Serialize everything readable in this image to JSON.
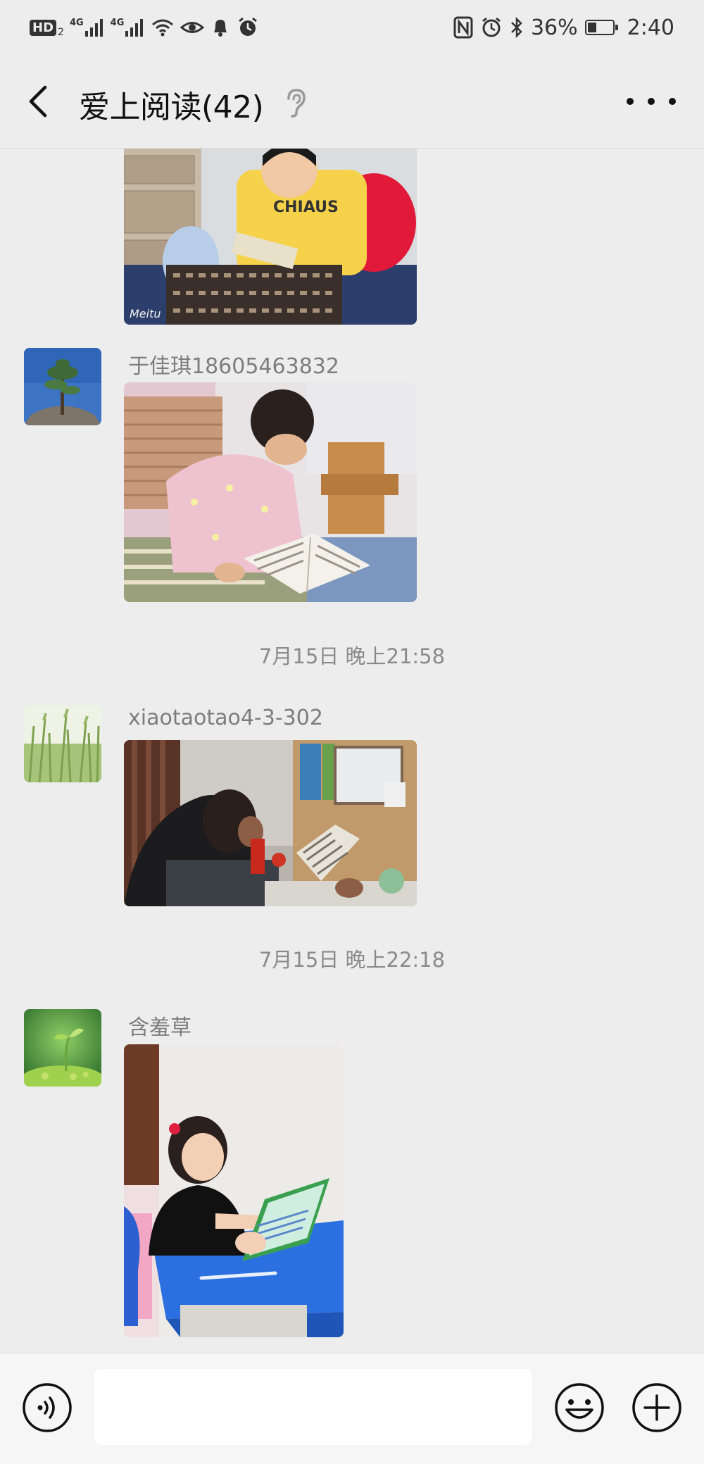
{
  "status_bar": {
    "left_badge": "HD",
    "left_badge_sub": "2",
    "network_1": "4G",
    "network_2": "4G",
    "battery_text": "36%",
    "battery_level": 0.36,
    "time": "2:40",
    "icons": [
      "signal-icon",
      "signal-icon",
      "wifi-icon",
      "eye-icon",
      "bell-icon",
      "alarm-icon",
      "nfc-icon",
      "alarm-clock-icon",
      "bluetooth-icon",
      "battery-icon"
    ]
  },
  "header": {
    "title": "爱上阅读(42)",
    "back_icon": "chevron-left-icon",
    "mute_icon": "ear-icon",
    "more_icon": "more-dots-icon"
  },
  "messages": [
    {
      "type": "image",
      "sender": "",
      "avatar_icon": "",
      "photo_desc": "boy in yellow shirt reading"
    },
    {
      "type": "image",
      "sender": "于佳琪18605463832",
      "avatar_icon": "pine-tree-avatar",
      "photo_desc": "girl in pink reading book"
    },
    {
      "type": "timestamp",
      "text": "7月15日 晚上21:58"
    },
    {
      "type": "image",
      "sender": "xiaotaotao4-3-302",
      "avatar_icon": "grass-avatar",
      "photo_desc": "child reading at desk"
    },
    {
      "type": "timestamp",
      "text": "7月15日 晚上22:18"
    },
    {
      "type": "image",
      "sender": "含羞草",
      "avatar_icon": "sprout-avatar",
      "photo_desc": "girl reading at blue desk"
    }
  ],
  "input_bar": {
    "voice_icon": "voice-icon",
    "emoji_icon": "emoji-icon",
    "plus_icon": "plus-icon",
    "input_value": "",
    "input_placeholder": ""
  },
  "colors": {
    "background": "#ededed",
    "sender_text": "#7d7d7d",
    "timestamp_text": "#8a8a8a",
    "input_bar": "#f6f6f6"
  }
}
